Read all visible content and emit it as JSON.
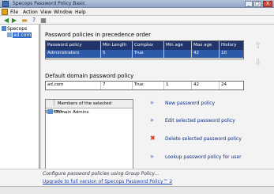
{
  "window": {
    "title": "Specops Password Policy Basic",
    "controls": [
      "_",
      "□",
      "X"
    ]
  },
  "menu": [
    "File",
    "Action",
    "View",
    "Window",
    "Help"
  ],
  "toolbar_icons": [
    "back-icon",
    "forward-icon",
    "folder-icon",
    "help-icon",
    "properties-icon"
  ],
  "tree": {
    "root": "Specops",
    "child": "ad.com"
  },
  "policies": {
    "heading": "Password policies in precedence order",
    "columns": [
      "Password policy",
      "Min Length",
      "Complex",
      "Min age",
      "Max age",
      "History"
    ],
    "rows": [
      [
        "Administrators",
        "5",
        "True",
        "",
        "42",
        "10"
      ]
    ]
  },
  "default_policy": {
    "heading": "Default domain password policy",
    "values": [
      "ad.com",
      "7",
      "True",
      "1",
      "42",
      "24"
    ]
  },
  "members": {
    "header": "Members of the selected passwo...",
    "items": [
      "Domain Admins"
    ]
  },
  "actions": [
    {
      "label": "New password policy",
      "icon": "arrow-icon",
      "color": "#2a63c8"
    },
    {
      "label": "Edit selected password policy",
      "icon": "arrow-icon",
      "color": "#2a63c8"
    },
    {
      "label": "Delete selected password policy",
      "icon": "delete-icon",
      "color": "#d23a1c"
    },
    {
      "label": "Lookup password policy for user",
      "icon": "arrow-icon",
      "color": "#2a63c8"
    }
  ],
  "footer": {
    "note": "Configure password policies using Group Policy...",
    "upgrade_link": "Upgrade to full version of Specops Password Policy™ 2"
  }
}
